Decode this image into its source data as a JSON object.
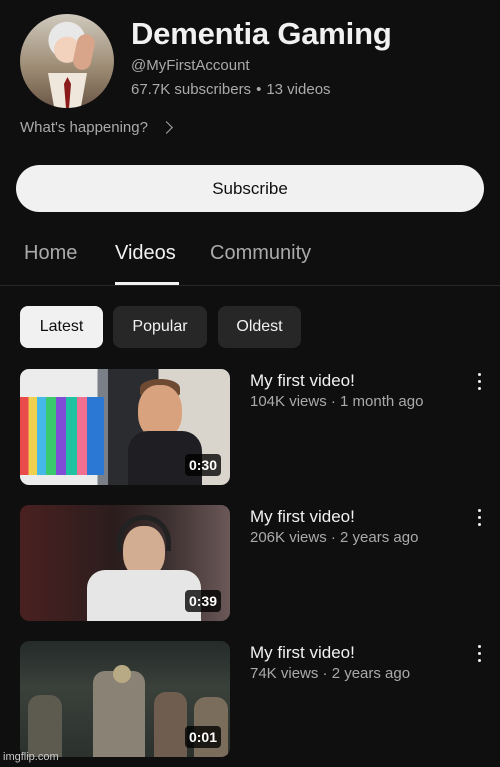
{
  "channel": {
    "name": "Dementia Gaming",
    "handle": "@MyFirstAccount",
    "subscribers": "67.7K subscribers",
    "separator": "•",
    "video_count": "13 videos",
    "status_prompt": "What's happening?",
    "subscribe_label": "Subscribe"
  },
  "tabs": [
    {
      "label": "Home",
      "active": false
    },
    {
      "label": "Videos",
      "active": true
    },
    {
      "label": "Community",
      "active": false
    }
  ],
  "filters": [
    {
      "label": "Latest",
      "selected": true
    },
    {
      "label": "Popular",
      "selected": false
    },
    {
      "label": "Oldest",
      "selected": false
    }
  ],
  "videos": [
    {
      "title": "My first video!",
      "meta": "104K views · 1 month ago",
      "duration": "0:30"
    },
    {
      "title": "My first video!",
      "meta": "206K views · 2 years ago",
      "duration": "0:39"
    },
    {
      "title": "My first video!",
      "meta": "74K views · 2 years ago",
      "duration": "0:01"
    }
  ],
  "watermark": "imgflip.com",
  "colors": {
    "background": "#0f0f0f",
    "chip": "#272727",
    "primary_text": "#f1f1f1",
    "secondary_text": "#aaaaaa"
  },
  "icons": [
    "chevron-right-icon",
    "more-vertical-icon"
  ]
}
